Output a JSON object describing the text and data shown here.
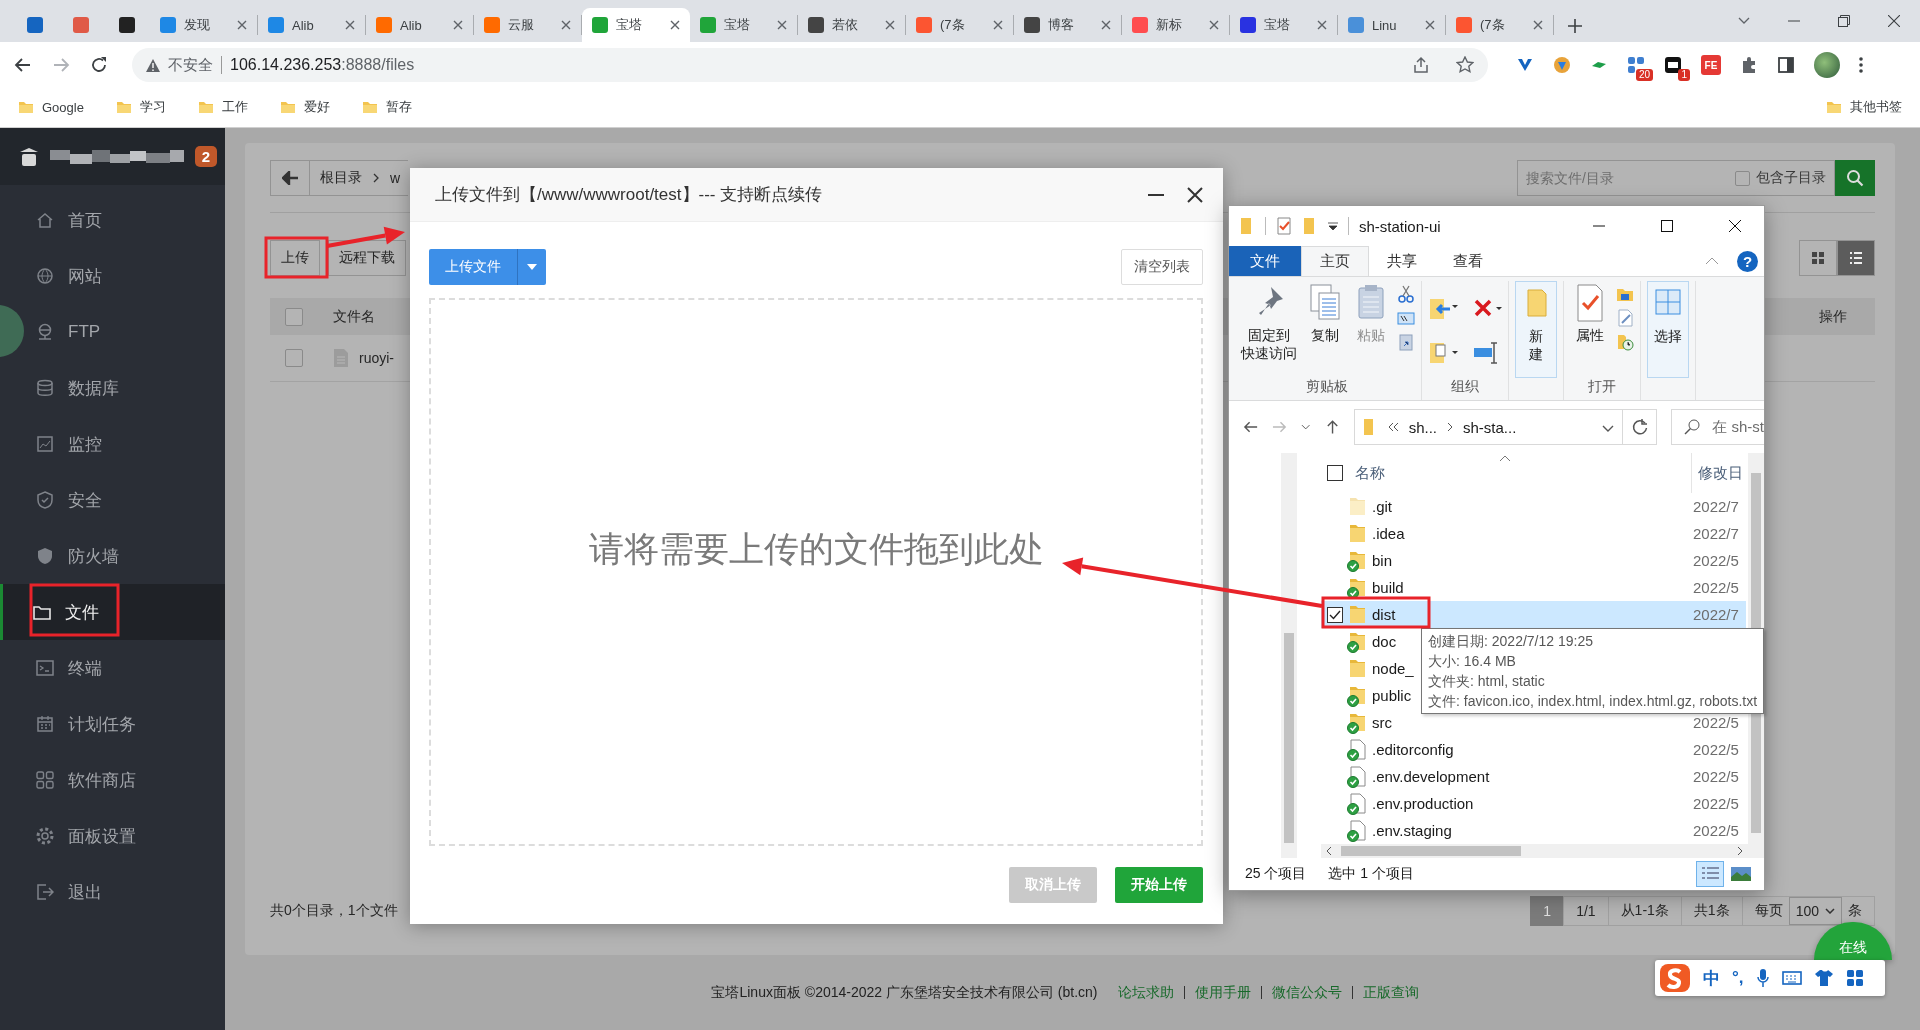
{
  "browser": {
    "tabs": [
      {
        "kind": "pinned",
        "color": "#1565c0",
        "selected": false
      },
      {
        "kind": "pinned",
        "color": "#e05a47",
        "selected": false
      },
      {
        "kind": "pinned",
        "color": "#222222",
        "selected": false
      },
      {
        "kind": "normal",
        "title": "发现",
        "color": "#1e88e5",
        "selected": false
      },
      {
        "kind": "normal",
        "title": "Alib",
        "color": "#1e88e5",
        "selected": false
      },
      {
        "kind": "normal",
        "title": "Alib",
        "color": "#ff6a00",
        "selected": false
      },
      {
        "kind": "normal",
        "title": "云服",
        "color": "#ff6a00",
        "selected": false
      },
      {
        "kind": "normal",
        "title": "宝塔",
        "color": "#20a53a",
        "selected": true
      },
      {
        "kind": "normal",
        "title": "宝塔",
        "color": "#20a53a",
        "selected": false
      },
      {
        "kind": "normal",
        "title": "若依",
        "color": "#444444",
        "selected": false
      },
      {
        "kind": "normal",
        "title": "(7条",
        "color": "#fc5531",
        "selected": false
      },
      {
        "kind": "normal",
        "title": "博客",
        "color": "#444444",
        "selected": false
      },
      {
        "kind": "normal",
        "title": "新标",
        "color": "#ff4d4f",
        "selected": false
      },
      {
        "kind": "normal",
        "title": "宝塔",
        "color": "#2932e1",
        "selected": false
      },
      {
        "kind": "normal",
        "title": "Linu",
        "color": "#4a90d9",
        "selected": false
      },
      {
        "kind": "normal",
        "title": "(7条",
        "color": "#fc5531",
        "selected": false
      }
    ],
    "address": {
      "warning": "不安全",
      "host": "106.14.236.253",
      "path": ":8888/files"
    },
    "extensions": [
      {
        "color": "#1565c0"
      },
      {
        "color": "#e8a33a"
      },
      {
        "color": "#1e9e4a"
      },
      {
        "color": "#3f7fd0",
        "badge": "20"
      },
      {
        "color": "#111111",
        "badge": "1"
      },
      {
        "color": "#e53935",
        "label": "FE"
      }
    ],
    "bookmarks": [
      "Google",
      "学习",
      "工作",
      "爱好",
      "暂存"
    ],
    "other_bookmarks": "其他书签"
  },
  "sidebar": {
    "badge": "2",
    "items": [
      {
        "label": "首页",
        "selected": false
      },
      {
        "label": "网站",
        "selected": false
      },
      {
        "label": "FTP",
        "selected": false
      },
      {
        "label": "数据库",
        "selected": false
      },
      {
        "label": "监控",
        "selected": false
      },
      {
        "label": "安全",
        "selected": false
      },
      {
        "label": "防火墙",
        "selected": false
      },
      {
        "label": "文件",
        "selected": true
      },
      {
        "label": "终端",
        "selected": false
      },
      {
        "label": "计划任务",
        "selected": false
      },
      {
        "label": "软件商店",
        "selected": false
      },
      {
        "label": "面板设置",
        "selected": false
      },
      {
        "label": "退出",
        "selected": false
      }
    ]
  },
  "file_manager": {
    "breadcrumb": [
      "根目录",
      "w"
    ],
    "search": {
      "placeholder": "搜索文件/目录"
    },
    "include_subdirs": {
      "label": "包含子目录",
      "checked": false
    },
    "toolbar": [
      "上传",
      "远程下载"
    ],
    "views": [
      {
        "selected": false
      },
      {
        "selected": true
      }
    ],
    "all_checked": false,
    "columns": [
      "文件名",
      "操作"
    ],
    "rows": [
      {
        "name": "ruoyi-",
        "checked": false
      }
    ],
    "summary": "共0个目录，1个文件",
    "pagination": {
      "current": "1",
      "pages": "1/1",
      "range": "从1-1条",
      "total": "共1条",
      "per_page_label": "每页",
      "per_page": "100",
      "unit": "条"
    }
  },
  "footer": {
    "text": "宝塔Linux面板 ©2014-2022 广东堡塔安全技术有限公司 (bt.cn)",
    "links": [
      "论坛求助",
      "使用手册",
      "微信公众号",
      "正版查询"
    ]
  },
  "upload_dialog": {
    "title": "上传文件到【/www/wwwroot/test】--- 支持断点续传",
    "upload_button": "上传文件",
    "clear_button": "清空列表",
    "drop_hint": "请将需要上传的文件拖到此处",
    "cancel_button": {
      "label": "取消上传",
      "disabled": true
    },
    "start_button": "开始上传"
  },
  "explorer": {
    "title": "sh-station-ui",
    "ribbon_tabs": [
      {
        "label": "文件",
        "kind": "menu",
        "selected": false
      },
      {
        "label": "主页",
        "kind": "tab",
        "selected": true
      },
      {
        "label": "共享",
        "kind": "tab",
        "selected": false
      },
      {
        "label": "查看",
        "kind": "tab",
        "selected": false
      }
    ],
    "help_label": "?",
    "ribbon_groups": [
      {
        "label": "剪贴板",
        "buttons": [
          {
            "lines": [
              "固定到",
              "快速访问"
            ],
            "disabled": false
          },
          {
            "lines": [
              "复制"
            ],
            "disabled": false
          },
          {
            "lines": [
              "粘贴"
            ],
            "disabled": true
          }
        ]
      },
      {
        "label": "组织"
      },
      {
        "buttons": [
          {
            "lines": [
              "新",
              "建"
            ],
            "disabled": false
          }
        ]
      },
      {
        "label": "打开",
        "buttons": [
          {
            "lines": [
              "属性"
            ],
            "disabled": false
          }
        ]
      },
      {
        "buttons": [
          {
            "lines": [
              "选择"
            ],
            "disabled": false
          }
        ]
      }
    ],
    "path": [
      "sh...",
      "sh-sta..."
    ],
    "search_placeholder": "在 sh-st",
    "all_checked": false,
    "columns": [
      "名称",
      "修改日"
    ],
    "files": [
      {
        "name": ".git",
        "kind": "folder",
        "hidden": true,
        "synced": false,
        "date": "2022/7",
        "selected": false
      },
      {
        "name": ".idea",
        "kind": "folder",
        "hidden": false,
        "synced": false,
        "date": "2022/7",
        "selected": false
      },
      {
        "name": "bin",
        "kind": "folder",
        "hidden": false,
        "synced": true,
        "date": "2022/5",
        "selected": false
      },
      {
        "name": "build",
        "kind": "folder",
        "hidden": false,
        "synced": true,
        "date": "2022/5",
        "selected": false
      },
      {
        "name": "dist",
        "kind": "folder",
        "hidden": false,
        "synced": false,
        "date": "2022/7",
        "selected": true
      },
      {
        "name": "doc",
        "kind": "folder",
        "hidden": false,
        "synced": true,
        "selected": false
      },
      {
        "name": "node_",
        "kind": "folder",
        "hidden": false,
        "synced": false,
        "selected": false
      },
      {
        "name": "public",
        "kind": "folder",
        "hidden": false,
        "synced": true,
        "selected": false
      },
      {
        "name": "src",
        "kind": "folder",
        "hidden": false,
        "synced": true,
        "date": "2022/5",
        "selected": false
      },
      {
        "name": ".editorconfig",
        "kind": "file",
        "hidden": false,
        "synced": true,
        "date": "2022/5",
        "selected": false
      },
      {
        "name": ".env.development",
        "kind": "file",
        "hidden": false,
        "synced": true,
        "date": "2022/5",
        "selected": false
      },
      {
        "name": ".env.production",
        "kind": "file",
        "hidden": false,
        "synced": true,
        "date": "2022/5",
        "selected": false
      },
      {
        "name": ".env.staging",
        "kind": "file",
        "hidden": false,
        "synced": true,
        "date": "2022/5",
        "selected": false
      }
    ],
    "tooltip": [
      "创建日期: 2022/7/12 19:25",
      "大小: 16.4 MB",
      "文件夹: html, static",
      "文件: favicon.ico, index.html, index.html.gz, robots.txt"
    ],
    "status": [
      "25 个项目",
      "选中 1 个项目"
    ]
  },
  "ime": {
    "mode": "中",
    "punctuation": "°,"
  },
  "online_button": "在线"
}
